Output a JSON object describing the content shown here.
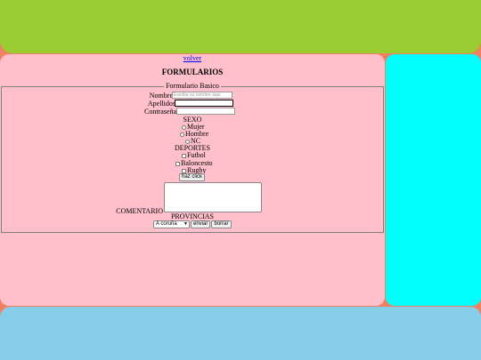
{
  "nav": {
    "volver": "volver"
  },
  "title": "FORMULARIOS",
  "form": {
    "legend": "Formulario Basico",
    "nombre_label": "Nombre",
    "nombre_placeholder": "Escriba su nombre aqui",
    "apellidos_label": "Apellidos",
    "contrasena_label": "Contraseña",
    "sexo_heading": "SEXO",
    "sexo_options": [
      "Mujer",
      "Hombre",
      "NC"
    ],
    "deportes_heading": "DEPORTES",
    "deportes_options": [
      "Futbol",
      "Baloncesto",
      "Rugby"
    ],
    "haz_click": "haz click",
    "comentario_label": "COMENTARIO",
    "provincias_heading": "PROVINCIAS",
    "provincia_selected": "A coruña",
    "enviar": "enviar",
    "borrar": "borrar"
  },
  "colors": {
    "header": "#9acd32",
    "main": "#ffc0cb",
    "aside": "#00ffff",
    "footer": "#87ceeb",
    "background": "#f08060"
  }
}
